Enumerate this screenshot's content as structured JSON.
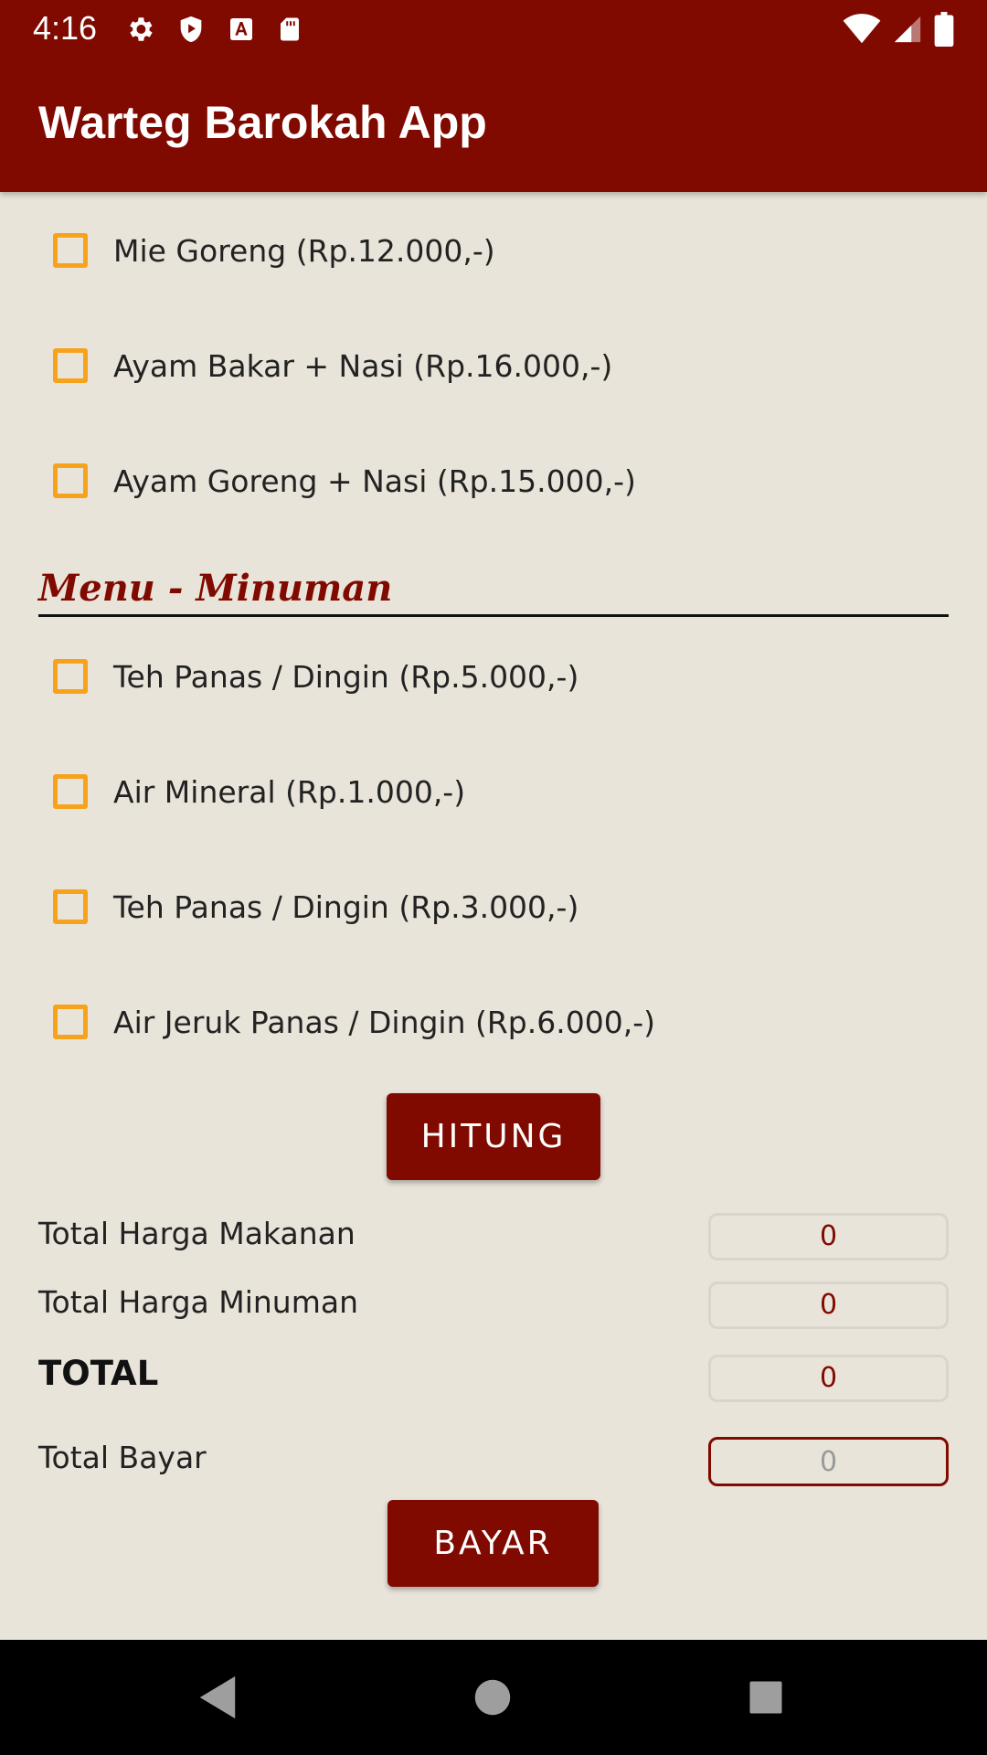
{
  "status_bar": {
    "time": "4:16",
    "left_icons": [
      "gear-icon",
      "shield-play-icon",
      "a-box-icon",
      "sd-card-icon"
    ],
    "right_icons": [
      "wifi-icon",
      "signal-icon",
      "battery-icon"
    ]
  },
  "app_bar": {
    "title": "Warteg Barokah App"
  },
  "food_items": [
    {
      "label": "Mie Goreng (Rp.12.000,-)",
      "checked": false
    },
    {
      "label": "Ayam Bakar + Nasi (Rp.16.000,-)",
      "checked": false
    },
    {
      "label": "Ayam Goreng + Nasi (Rp.15.000,-)",
      "checked": false
    }
  ],
  "drinks_section": {
    "title": "Menu - Minuman"
  },
  "drink_items": [
    {
      "label": "Teh Panas / Dingin (Rp.5.000,-)",
      "checked": false
    },
    {
      "label": "Air Mineral (Rp.1.000,-)",
      "checked": false
    },
    {
      "label": "Teh Panas / Dingin (Rp.3.000,-)",
      "checked": false
    },
    {
      "label": "Air Jeruk Panas / Dingin (Rp.6.000,-)",
      "checked": false
    }
  ],
  "hitung_button": {
    "label": "HITUNG"
  },
  "summary": {
    "food_total_label": "Total Harga Makanan",
    "food_total_value": "0",
    "drink_total_label": "Total Harga Minuman",
    "drink_total_value": "0",
    "total_label": "TOTAL",
    "total_value": "0",
    "pay_label": "Total Bayar",
    "pay_placeholder": "0",
    "pay_value": ""
  },
  "bayar_button": {
    "label": "BAYAR"
  },
  "nav_bar": {
    "buttons": [
      "back-icon",
      "home-icon",
      "recents-icon"
    ]
  },
  "colors": {
    "primary": "#800a00",
    "background": "#e9e4da",
    "checkbox": "#f7a21b"
  }
}
